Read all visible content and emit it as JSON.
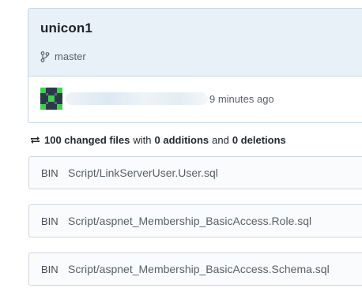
{
  "commit": {
    "title": "unicon1",
    "branch": "master",
    "author_name": "",
    "time_ago": "9 minutes ago"
  },
  "summary": {
    "changed_files": "100 changed files",
    "with": "with",
    "additions": "0 additions",
    "and": "and",
    "deletions": "0 deletions"
  },
  "files": [
    {
      "badge": "BIN",
      "path": "Script/LinkServerUser.User.sql"
    },
    {
      "badge": "BIN",
      "path": "Script/aspnet_Membership_BasicAccess.Role.sql"
    },
    {
      "badge": "BIN",
      "path": "Script/aspnet_Membership_BasicAccess.Schema.sql"
    }
  ],
  "colors": {
    "header_bg": "#e8f1f8",
    "avatar_green": "#3fd14a",
    "avatar_dark": "#2b3a4a"
  },
  "icons": {
    "branch": "git-branch-icon",
    "sync": "sync-icon"
  }
}
